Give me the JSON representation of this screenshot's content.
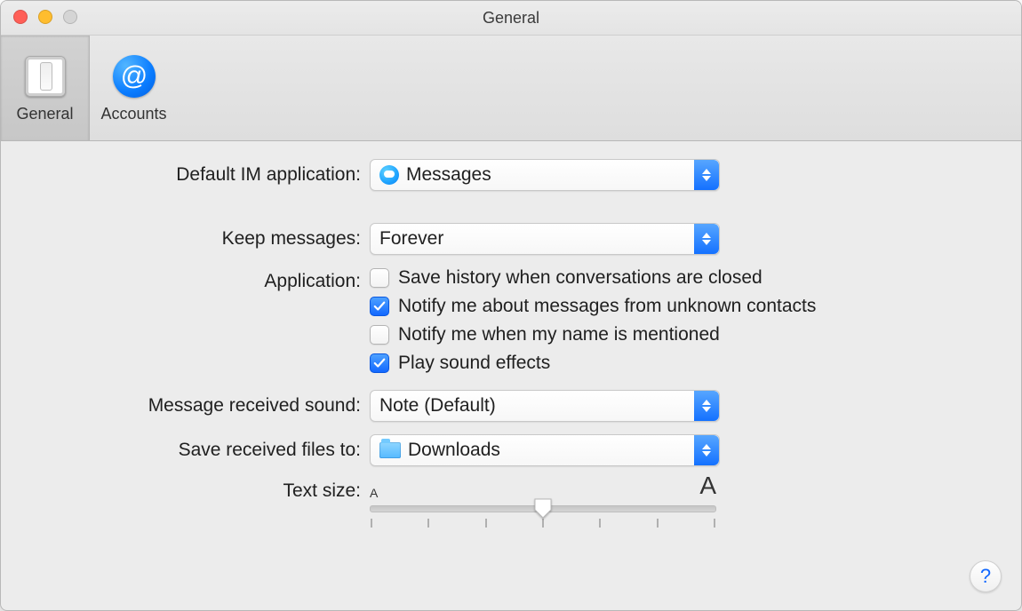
{
  "window": {
    "title": "General"
  },
  "toolbar": {
    "items": [
      {
        "id": "general",
        "label": "General",
        "selected": true
      },
      {
        "id": "accounts",
        "label": "Accounts",
        "selected": false
      }
    ]
  },
  "labels": {
    "default_im": "Default IM application:",
    "keep_messages": "Keep messages:",
    "application": "Application:",
    "received_sound": "Message received sound:",
    "save_files_to": "Save received files to:",
    "text_size": "Text size:"
  },
  "default_im_app": {
    "value": "Messages"
  },
  "keep_messages": {
    "value": "Forever"
  },
  "application_opts": {
    "save_history": {
      "label": "Save history when conversations are closed",
      "checked": false
    },
    "notify_unknown": {
      "label": "Notify me about messages from unknown contacts",
      "checked": true
    },
    "notify_mention": {
      "label": "Notify me when my name is mentioned",
      "checked": false
    },
    "play_sound": {
      "label": "Play sound effects",
      "checked": true
    }
  },
  "received_sound": {
    "value": "Note (Default)"
  },
  "save_files_to": {
    "value": "Downloads"
  },
  "text_size": {
    "min_label": "A",
    "max_label": "A",
    "ticks": 7,
    "value_index": 3
  },
  "help": {
    "glyph": "?"
  }
}
